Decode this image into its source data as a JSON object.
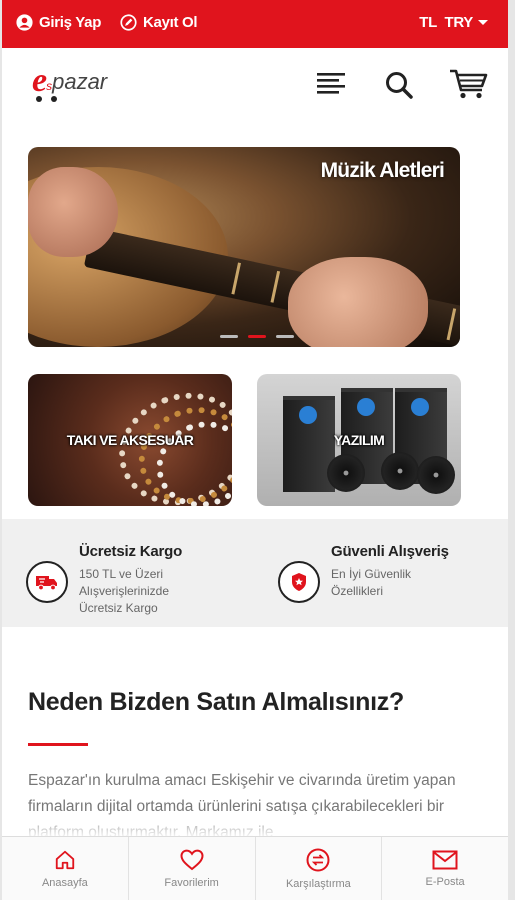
{
  "topbar": {
    "login_label": "Giriş Yap",
    "register_label": "Kayıt Ol",
    "currency_label": "TL  TRY",
    "background_color": "#e0141d"
  },
  "header": {
    "logo": {
      "mark": "e",
      "small": "s",
      "text": "pazar"
    },
    "icons": [
      "menu-icon",
      "search-icon",
      "cart-icon"
    ]
  },
  "hero": {
    "title": "Müzik Aletleri",
    "slides": 3,
    "active_slide": 2
  },
  "categories": [
    {
      "label": "TAKI VE AKSESUAR"
    },
    {
      "label": "YAZILIM"
    }
  ],
  "features": [
    {
      "title": "Ücretsiz Kargo",
      "text": "150 TL ve Üzeri Alışverişlerinizde Ücretsiz Kargo",
      "icon": "truck-icon"
    },
    {
      "title": "Güvenli Alışveriş",
      "text": "En İyi Güvenlik Özellikleri",
      "icon": "shield-icon"
    }
  ],
  "why": {
    "heading": "Neden Bizden Satın Almalısınız?",
    "body": "Espazar'ın kurulma amacı Eskişehir ve civarında üretim yapan firmaların dijital ortamda ürünlerini satışa çıkarabilecekleri bir platform oluşturmaktır. Markamız ile"
  },
  "bottom_nav": [
    {
      "label": "Anasayfa",
      "icon": "home-icon"
    },
    {
      "label": "Favorilerim",
      "icon": "heart-icon"
    },
    {
      "label": "Karşılaştırma",
      "icon": "compare-icon"
    },
    {
      "label": "E-Posta",
      "icon": "mail-icon"
    }
  ],
  "accent_color": "#e0141d"
}
